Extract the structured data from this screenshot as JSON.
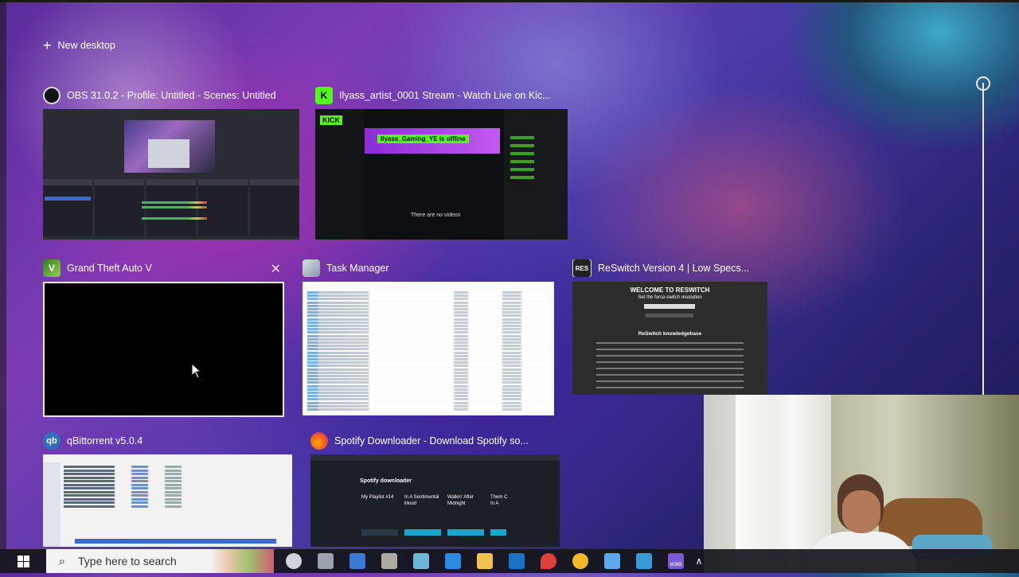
{
  "new_desktop": {
    "label": "New desktop"
  },
  "windows": [
    {
      "title": "OBS 31.0.2 - Profile: Untitled - Scenes: Untitled",
      "icon": "obs-icon"
    },
    {
      "title": "Ilyass_artist_0001 Stream - Watch Live on Kic...",
      "icon": "kick-icon",
      "thumb": {
        "logo": "KICK",
        "banner": "Ilyass_Gaming_YE is offline",
        "empty": "There are no videos"
      }
    },
    {
      "title": "Grand Theft Auto V",
      "icon": "gta-icon"
    },
    {
      "title": "Task Manager",
      "icon": "task-manager-icon"
    },
    {
      "title": "ReSwitch Version 4 | Low Specs...",
      "icon": "reswitch-icon",
      "icon_text": "RES",
      "thumb": {
        "heading": "WELCOME TO RESWITCH",
        "sub": "Set the force-switch resolution",
        "section": "ReSwitch knowledgebase"
      }
    },
    {
      "title": "qBittorrent v5.0.4",
      "icon": "qbittorrent-icon",
      "icon_text": "qb"
    },
    {
      "title": "Spotify Downloader - Download Spotify so...",
      "icon": "firefox-icon",
      "thumb": {
        "heading": "Spotify downloader",
        "cards": [
          "My Playlist #14",
          "In A Sentimental Mood",
          "Walkin' After Midnight",
          "Them C In A"
        ]
      }
    }
  ],
  "taskbar": {
    "search_placeholder": "Type here to search",
    "icons": [
      {
        "name": "settings-icon",
        "color": "#cfd3da"
      },
      {
        "name": "camera-icon",
        "color": "#9aa3ad"
      },
      {
        "name": "calculator-icon",
        "color": "#3a7bd5"
      },
      {
        "name": "gimp-icon",
        "color": "#b0a9a0"
      },
      {
        "name": "notepad-icon",
        "color": "#6fb7d8"
      },
      {
        "name": "photos-icon",
        "color": "#2a8be0"
      },
      {
        "name": "file-explorer-icon",
        "color": "#f2c14e"
      },
      {
        "name": "outlook-icon",
        "color": "#1a73c8"
      },
      {
        "name": "maps-icon",
        "color": "#e0403a"
      },
      {
        "name": "chrome-canary-icon",
        "color": "#f3b72a"
      },
      {
        "name": "copilot-star-icon",
        "color": "#5aa8f0"
      },
      {
        "name": "store-icon",
        "color": "#3a9ad8"
      },
      {
        "name": "microsoft365-icon",
        "color": "#7a5ad8"
      }
    ],
    "m365_label": "M365"
  }
}
